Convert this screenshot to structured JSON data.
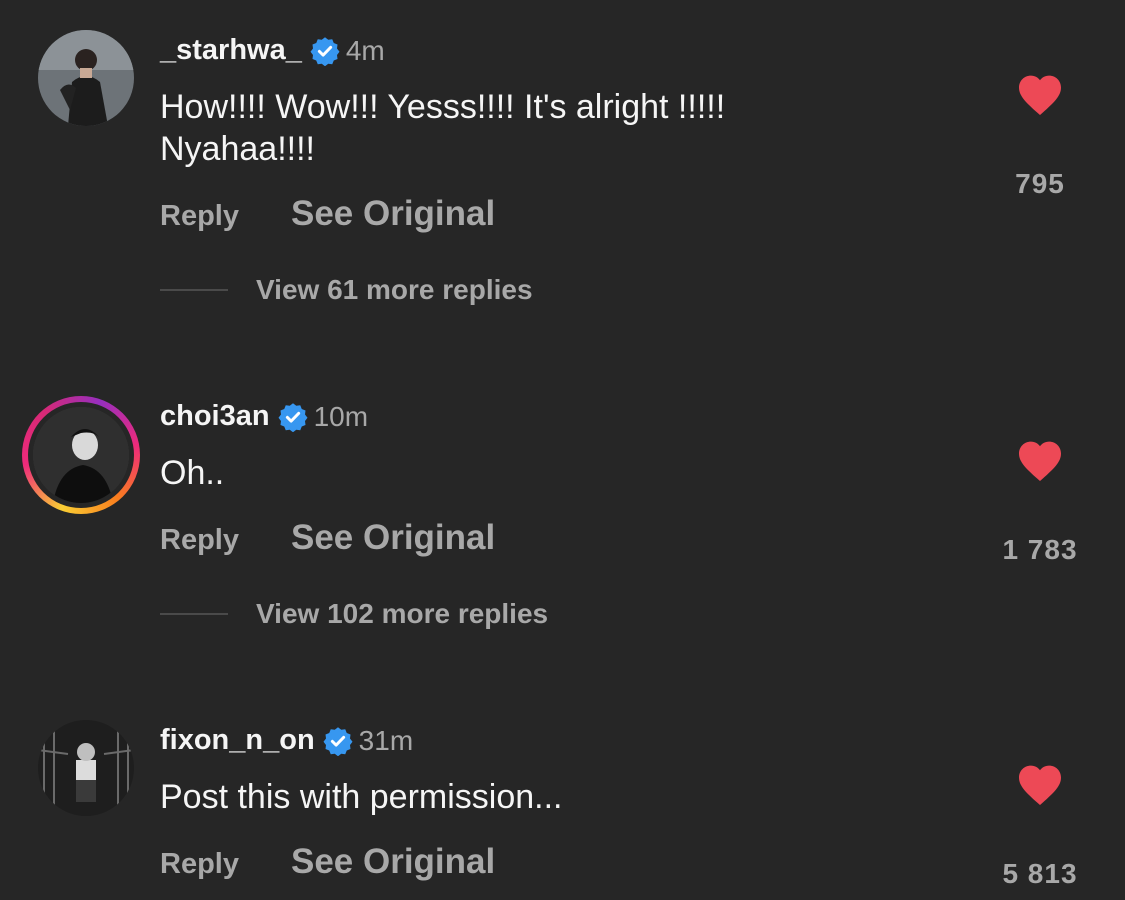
{
  "colors": {
    "background": "#262626",
    "primary_text": "#f5f5f5",
    "secondary_text": "#a8a8a8",
    "verified_blue": "#3797f0",
    "heart_red": "#ed4956"
  },
  "comments": [
    {
      "username": "_starhwa_",
      "verified": true,
      "time": "4m",
      "text": "How!!!! Wow!!! Yesss!!!! It's alright !!!!! Nyahaa!!!!",
      "reply_label": "Reply",
      "see_original_label": "See Original",
      "likes": "795",
      "liked": true,
      "view_replies": "View 61 more replies",
      "avatar_icon": "avatar-photo",
      "has_story_ring": false
    },
    {
      "username": "choi3an",
      "verified": true,
      "time": "10m",
      "text": "Oh..",
      "reply_label": "Reply",
      "see_original_label": "See Original",
      "likes": "1 783",
      "liked": true,
      "view_replies": "View 102 more replies",
      "avatar_icon": "avatar-photo",
      "has_story_ring": true
    },
    {
      "username": "fixon_n_on",
      "verified": true,
      "time": "31m",
      "text": "Post this with permission...",
      "reply_label": "Reply",
      "see_original_label": "See Original",
      "likes": "5 813",
      "liked": true,
      "avatar_icon": "avatar-photo",
      "has_story_ring": false
    }
  ]
}
